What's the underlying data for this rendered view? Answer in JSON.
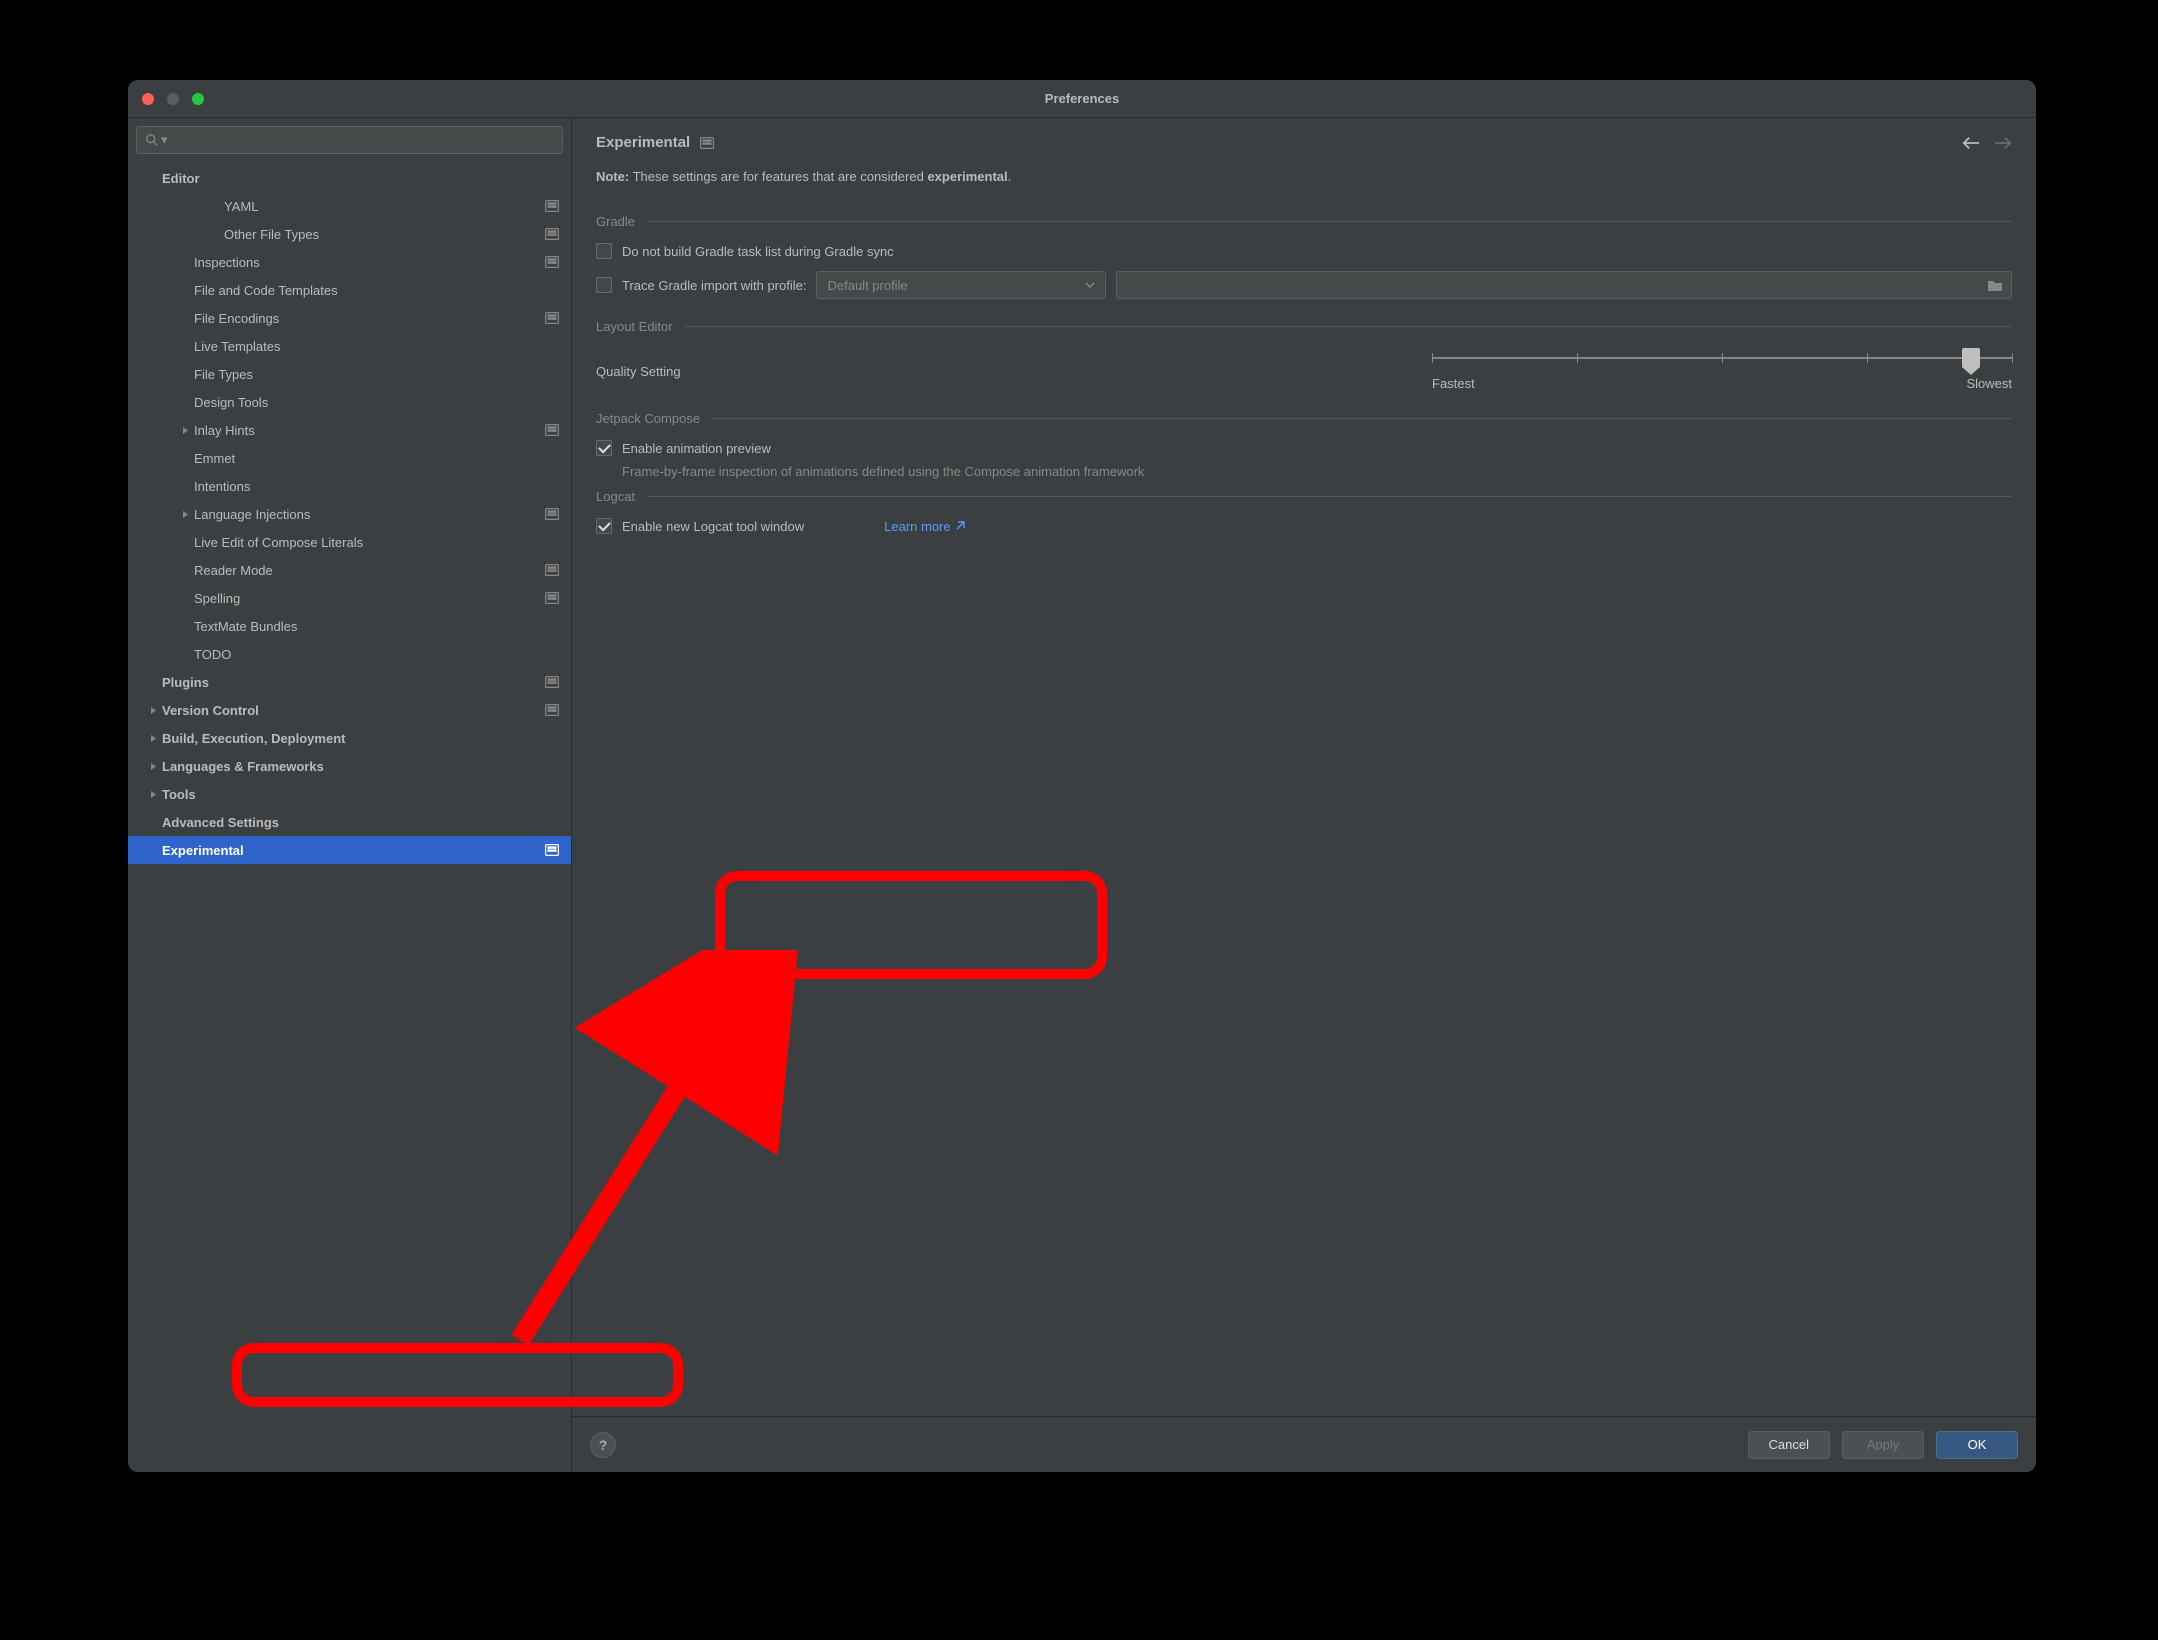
{
  "titlebar": {
    "title": "Preferences"
  },
  "search": {
    "placeholder": ""
  },
  "sidebar": [
    {
      "label": "Editor",
      "indent": 34,
      "bold": true,
      "chevron": false,
      "proj": false
    },
    {
      "label": "YAML",
      "indent": 96,
      "bold": false,
      "chevron": false,
      "proj": true
    },
    {
      "label": "Other File Types",
      "indent": 96,
      "bold": false,
      "chevron": false,
      "proj": true
    },
    {
      "label": "Inspections",
      "indent": 66,
      "bold": false,
      "chevron": false,
      "proj": true
    },
    {
      "label": "File and Code Templates",
      "indent": 66,
      "bold": false,
      "chevron": false,
      "proj": false
    },
    {
      "label": "File Encodings",
      "indent": 66,
      "bold": false,
      "chevron": false,
      "proj": true
    },
    {
      "label": "Live Templates",
      "indent": 66,
      "bold": false,
      "chevron": false,
      "proj": false
    },
    {
      "label": "File Types",
      "indent": 66,
      "bold": false,
      "chevron": false,
      "proj": false
    },
    {
      "label": "Design Tools",
      "indent": 66,
      "bold": false,
      "chevron": false,
      "proj": false
    },
    {
      "label": "Inlay Hints",
      "indent": 66,
      "bold": false,
      "chevron": true,
      "proj": true
    },
    {
      "label": "Emmet",
      "indent": 66,
      "bold": false,
      "chevron": false,
      "proj": false
    },
    {
      "label": "Intentions",
      "indent": 66,
      "bold": false,
      "chevron": false,
      "proj": false
    },
    {
      "label": "Language Injections",
      "indent": 66,
      "bold": false,
      "chevron": true,
      "proj": true
    },
    {
      "label": "Live Edit of Compose Literals",
      "indent": 66,
      "bold": false,
      "chevron": false,
      "proj": false
    },
    {
      "label": "Reader Mode",
      "indent": 66,
      "bold": false,
      "chevron": false,
      "proj": true
    },
    {
      "label": "Spelling",
      "indent": 66,
      "bold": false,
      "chevron": false,
      "proj": true
    },
    {
      "label": "TextMate Bundles",
      "indent": 66,
      "bold": false,
      "chevron": false,
      "proj": false
    },
    {
      "label": "TODO",
      "indent": 66,
      "bold": false,
      "chevron": false,
      "proj": false
    },
    {
      "label": "Plugins",
      "indent": 34,
      "bold": true,
      "chevron": false,
      "proj": true
    },
    {
      "label": "Version Control",
      "indent": 34,
      "bold": true,
      "chevron": true,
      "proj": true
    },
    {
      "label": "Build, Execution, Deployment",
      "indent": 34,
      "bold": true,
      "chevron": true,
      "proj": false
    },
    {
      "label": "Languages & Frameworks",
      "indent": 34,
      "bold": true,
      "chevron": true,
      "proj": false
    },
    {
      "label": "Tools",
      "indent": 34,
      "bold": true,
      "chevron": true,
      "proj": false
    },
    {
      "label": "Advanced Settings",
      "indent": 34,
      "bold": true,
      "chevron": false,
      "proj": false
    },
    {
      "label": "Experimental",
      "indent": 34,
      "bold": true,
      "chevron": false,
      "proj": true,
      "selected": true
    }
  ],
  "header": {
    "title": "Experimental"
  },
  "note": {
    "prefix": "Note:",
    "body1": " These settings are for features that are considered ",
    "bold2": "experimental",
    "body2": "."
  },
  "sections": {
    "gradle": {
      "title": "Gradle",
      "opt1": "Do not build Gradle task list during Gradle sync",
      "opt2": "Trace Gradle import with profile:",
      "profile": "Default profile"
    },
    "layout": {
      "title": "Layout Editor",
      "quality": "Quality Setting",
      "fastest": "Fastest",
      "slowest": "Slowest"
    },
    "compose": {
      "title": "Jetpack Compose",
      "opt": "Enable animation preview",
      "hint": "Frame-by-frame inspection of animations defined using the Compose animation framework"
    },
    "logcat": {
      "title": "Logcat",
      "opt": "Enable new Logcat tool window",
      "learn": "Learn more"
    }
  },
  "footer": {
    "cancel": "Cancel",
    "apply": "Apply",
    "ok": "OK"
  }
}
